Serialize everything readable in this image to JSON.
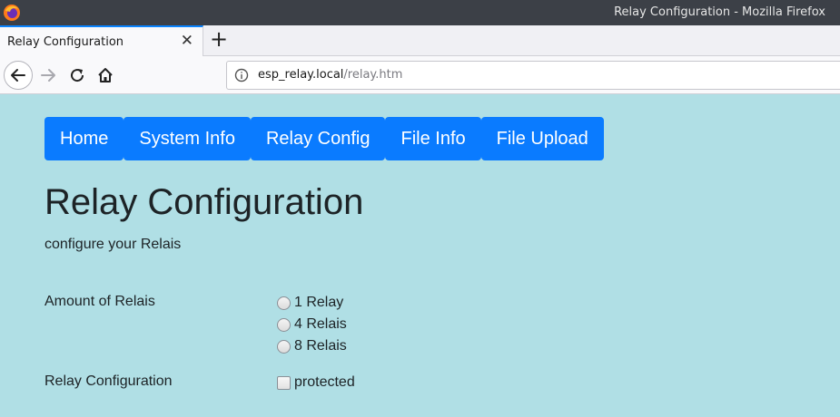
{
  "window": {
    "title": "Relay Configuration - Mozilla Firefox"
  },
  "tab": {
    "label": "Relay Configuration",
    "close_glyph": "✕"
  },
  "newtab": {
    "glyph": "+"
  },
  "nav": {
    "url_host": "esp_relay.local",
    "url_path": "/relay.htm"
  },
  "menu": {
    "items": [
      {
        "label": "Home"
      },
      {
        "label": "System Info"
      },
      {
        "label": "Relay Config"
      },
      {
        "label": "File Info"
      },
      {
        "label": "File Upload"
      }
    ]
  },
  "page": {
    "title": "Relay Configuration",
    "subtitle": "configure your Relais",
    "amount_label": "Amount of Relais",
    "amount_options": [
      {
        "label": "1 Relay",
        "selected": false
      },
      {
        "label": "4 Relais",
        "selected": false
      },
      {
        "label": "8 Relais",
        "selected": false
      }
    ],
    "config_label": "Relay Configuration",
    "protected_label": "protected",
    "protected_checked": false
  },
  "colors": {
    "page_bg": "#b0dfe5",
    "menu_bg": "#0a7bff",
    "accent": "#0a84ff"
  }
}
